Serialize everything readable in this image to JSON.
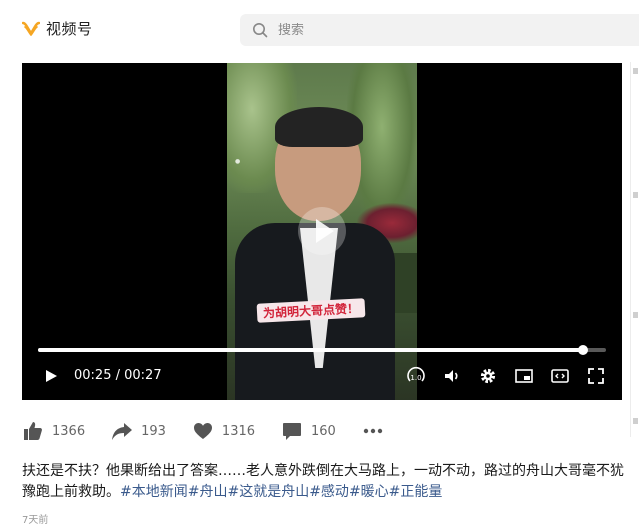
{
  "app": {
    "title": "视频号"
  },
  "search": {
    "placeholder": "搜索"
  },
  "video": {
    "caption_overlay": "为胡明大哥点赞！",
    "time_current": "00:25",
    "time_separator": " / ",
    "time_total": "00:27",
    "progress": 0.96,
    "speed_label": "1.0"
  },
  "actions": {
    "likes": "1366",
    "shares": "193",
    "favorites": "1316",
    "comments": "160"
  },
  "post": {
    "text": "扶还是不扶？他果断给出了答案……老人意外跌倒在大马路上，一动不动，路过的舟山大哥毫不犹豫跑上前救助。",
    "tags": [
      "#本地新闻",
      "#舟山",
      "#这就是舟山",
      "#感动",
      "#暖心",
      "#正能量"
    ],
    "date": "7天前"
  },
  "colors": {
    "brand": "#f5a623",
    "tag": "#3a5a8c",
    "player_bg": "#000000"
  }
}
